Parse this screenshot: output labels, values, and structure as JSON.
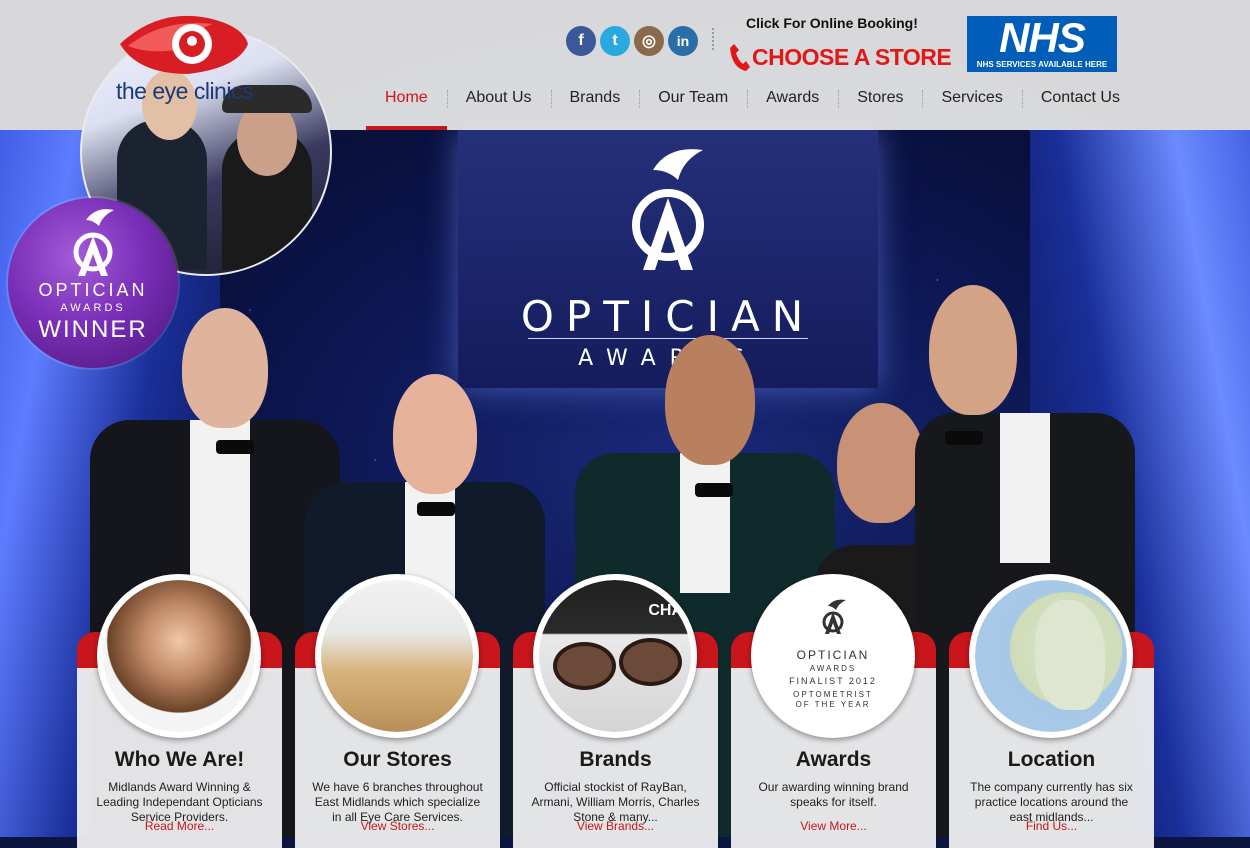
{
  "header": {
    "logo_text": "the eye clinics",
    "booking_text": "Click For Online Booking!",
    "choose_store_label": "CHOOSE A STORE",
    "nhs_logo_text": "NHS",
    "nhs_tagline": "NHS SERVICES AVAILABLE HERE"
  },
  "social": [
    {
      "name": "facebook-icon",
      "glyph": "f"
    },
    {
      "name": "twitter-icon",
      "glyph": "t"
    },
    {
      "name": "instagram-icon",
      "glyph": "◎"
    },
    {
      "name": "linkedin-icon",
      "glyph": "in"
    }
  ],
  "nav": {
    "items": [
      {
        "label": "Home",
        "active": true
      },
      {
        "label": "About Us"
      },
      {
        "label": "Brands"
      },
      {
        "label": "Our Team"
      },
      {
        "label": "Awards"
      },
      {
        "label": "Stores"
      },
      {
        "label": "Services"
      },
      {
        "label": "Contact Us"
      }
    ]
  },
  "hero": {
    "screen_title": "OPTICIAN",
    "screen_subtitle": "AWARDS",
    "badge_line1": "OPTICIAN",
    "badge_line2": "AWARDS",
    "badge_line3": "WINNER"
  },
  "cards": [
    {
      "title": "Who We Are!",
      "text": "Midlands Award Winning & Leading Independant Opticians Service Providers.",
      "link": "Read More..."
    },
    {
      "title": "Our Stores",
      "text": "We have 6 branches throughout East Midlands which specialize in all Eye Care Services.",
      "link": "View Stores..."
    },
    {
      "title": "Brands",
      "text": "Official stockist of RayBan, Armani, William Morris, Charles Stone & many...",
      "link": "View Brands..."
    },
    {
      "title": "Awards",
      "text": "Our awarding winning brand speaks for itself.",
      "link": "View More..."
    },
    {
      "title": "Location",
      "text": "The company currently has six practice locations around the east midlands...",
      "link": "Find Us..."
    }
  ],
  "awards_card_image": {
    "line1": "OPTICIAN",
    "line2": "AWARDS",
    "line3": "FINALIST 2012",
    "line4": "OPTOMETRIST",
    "line5": "OF THE YEAR"
  },
  "brand_logo_text": "CHA",
  "colors": {
    "accent_red": "#c8161c",
    "nhs_blue": "#005eb8",
    "nav_active": "#d0141a"
  }
}
